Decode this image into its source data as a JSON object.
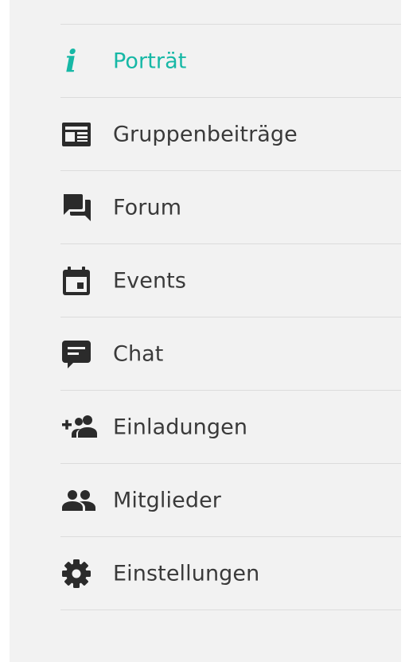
{
  "colors": {
    "accent": "#17b8a6",
    "text": "#3a3a3a",
    "icon": "#2b2b2b"
  },
  "menu": {
    "items": [
      {
        "label": "Porträt",
        "icon": "info-icon",
        "active": true
      },
      {
        "label": "Gruppenbeiträge",
        "icon": "newspaper-icon",
        "active": false
      },
      {
        "label": "Forum",
        "icon": "forum-icon",
        "active": false
      },
      {
        "label": "Events",
        "icon": "calendar-icon",
        "active": false
      },
      {
        "label": "Chat",
        "icon": "chat-icon",
        "active": false
      },
      {
        "label": "Einladungen",
        "icon": "add-users-icon",
        "active": false
      },
      {
        "label": "Mitglieder",
        "icon": "members-icon",
        "active": false
      },
      {
        "label": "Einstellungen",
        "icon": "gear-icon",
        "active": false
      }
    ]
  }
}
